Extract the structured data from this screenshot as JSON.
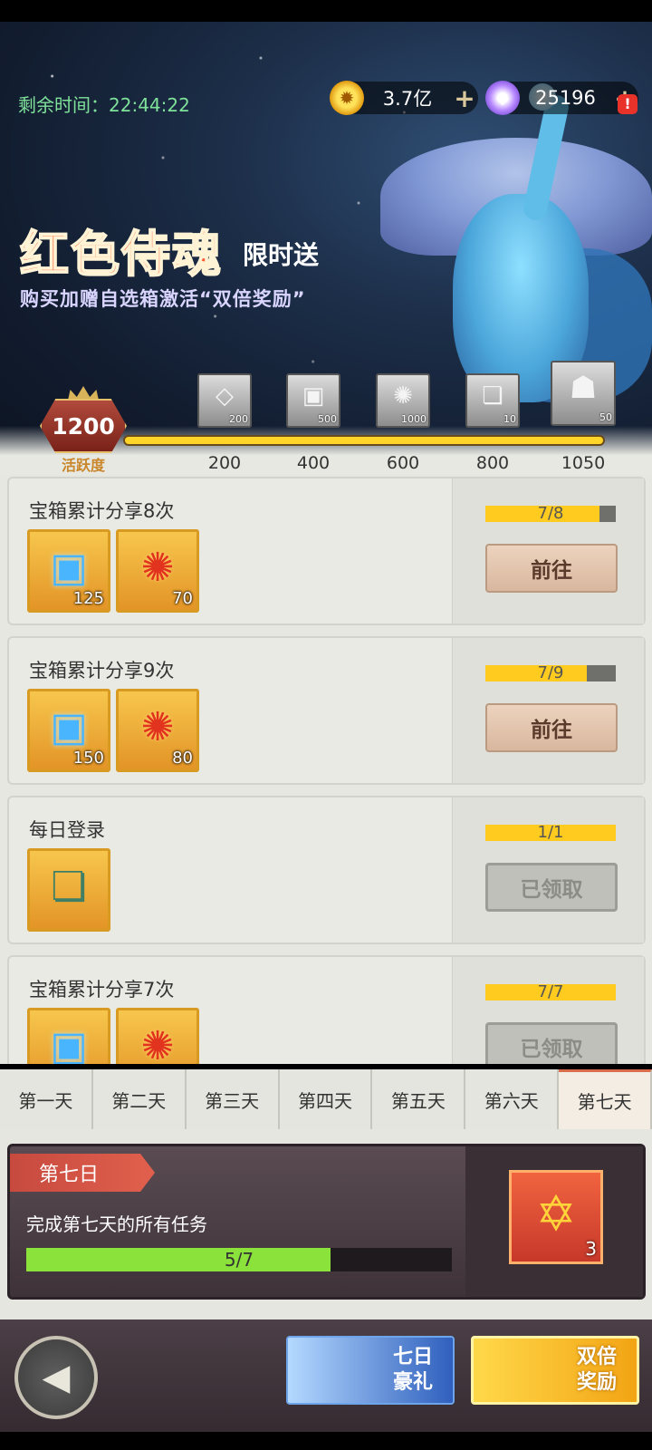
{
  "timer": {
    "label": "剩余时间：",
    "value": "22:44:22"
  },
  "currency": {
    "coins": "3.7亿",
    "gems": "25196",
    "alert": "!"
  },
  "promo": {
    "title": "红色侍魂",
    "tag": "限时送",
    "subtitle": "购买加赠自选箱激活“双倍奖励”"
  },
  "activity": {
    "value": "1200",
    "label": "活跃度",
    "progress": 1.0,
    "milestones": [
      {
        "label": "200",
        "count": "200",
        "icon": "diamond-icon"
      },
      {
        "label": "400",
        "count": "500",
        "icon": "cube-icon"
      },
      {
        "label": "600",
        "count": "1000",
        "icon": "medal-icon"
      },
      {
        "label": "800",
        "count": "10",
        "icon": "scroll-icon"
      },
      {
        "label": "1050",
        "count": "50",
        "icon": "hero-icon"
      }
    ]
  },
  "tasks": [
    {
      "title": "宝箱累计分享8次",
      "progress_text": "7/8",
      "progress": 0.875,
      "button": "前往",
      "state": "go",
      "rewards": [
        {
          "icon": "cube-icon",
          "count": "125"
        },
        {
          "icon": "medal-icon",
          "count": "70"
        }
      ]
    },
    {
      "title": "宝箱累计分享9次",
      "progress_text": "7/9",
      "progress": 0.778,
      "button": "前往",
      "state": "go",
      "rewards": [
        {
          "icon": "cube-icon",
          "count": "150"
        },
        {
          "icon": "medal-icon",
          "count": "80"
        }
      ]
    },
    {
      "title": "每日登录",
      "progress_text": "1/1",
      "progress": 1.0,
      "button": "已领取",
      "state": "done",
      "rewards": [
        {
          "icon": "scroll-icon",
          "count": ""
        }
      ]
    },
    {
      "title": "宝箱累计分享7次",
      "progress_text": "7/7",
      "progress": 1.0,
      "button": "已领取",
      "state": "done",
      "rewards": [
        {
          "icon": "cube-icon",
          "count": ""
        },
        {
          "icon": "medal-icon",
          "count": ""
        }
      ]
    }
  ],
  "tabs": [
    "第一天",
    "第二天",
    "第三天",
    "第四天",
    "第五天",
    "第六天",
    "第七天"
  ],
  "active_tab": 6,
  "day_reward": {
    "tag": "第七日",
    "text": "完成第七天的所有任务",
    "progress_text": "5/7",
    "progress": 0.714,
    "chest_count": "3"
  },
  "bottom": {
    "seven_label_1": "七日",
    "seven_label_2": "豪礼",
    "double_label_1": "双倍",
    "double_label_2": "奖励"
  }
}
